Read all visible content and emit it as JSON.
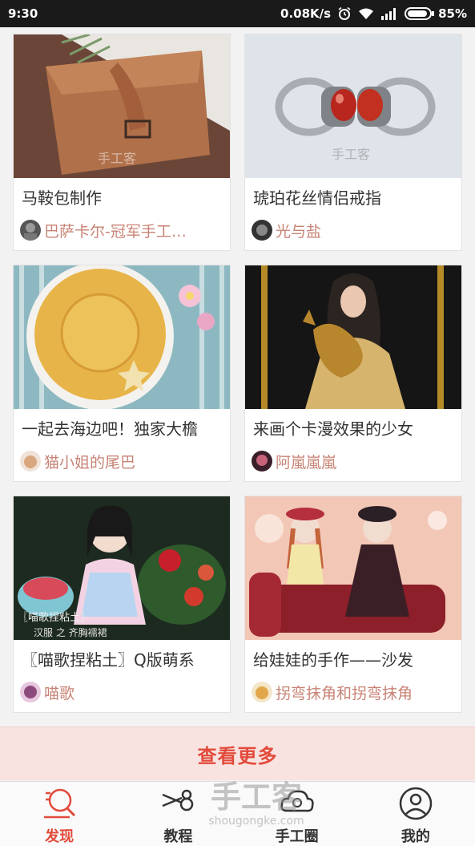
{
  "status_bar": {
    "time": "9:30",
    "network_speed": "0.08K/s",
    "battery": "85%",
    "icons": [
      "alarm-icon",
      "wifi-icon",
      "signal-icon",
      "battery-icon"
    ]
  },
  "cards": [
    {
      "title": "马鞍包制作",
      "author": "巴萨卡尔-冠军手工…"
    },
    {
      "title": "琥珀花丝情侣戒指",
      "author": "光与盐"
    },
    {
      "title": "一起去海边吧！独家大檐",
      "author": "猫小姐的尾巴"
    },
    {
      "title": "来画个卡漫效果的少女",
      "author": "阿嵐嵐嵐"
    },
    {
      "title": "〖喵歌捏粘土〗Q版萌系",
      "author": "喵歌"
    },
    {
      "title": "给娃娃的手作——沙发",
      "author": "拐弯抹角和拐弯抹角"
    }
  ],
  "load_more": {
    "label": "查看更多"
  },
  "tabbar": {
    "tabs": [
      {
        "label": "发现",
        "icon": "discover-icon",
        "active": true
      },
      {
        "label": "教程",
        "icon": "scissors-icon",
        "active": false
      },
      {
        "label": "手工圈",
        "icon": "community-icon",
        "active": false
      },
      {
        "label": "我的",
        "icon": "profile-icon",
        "active": false
      }
    ]
  },
  "watermark": {
    "text": "手工客",
    "url": "shougongke.com"
  },
  "colors": {
    "accent": "#e24a3b",
    "author": "#c88375",
    "load_more_bg": "#f8e3e0"
  }
}
